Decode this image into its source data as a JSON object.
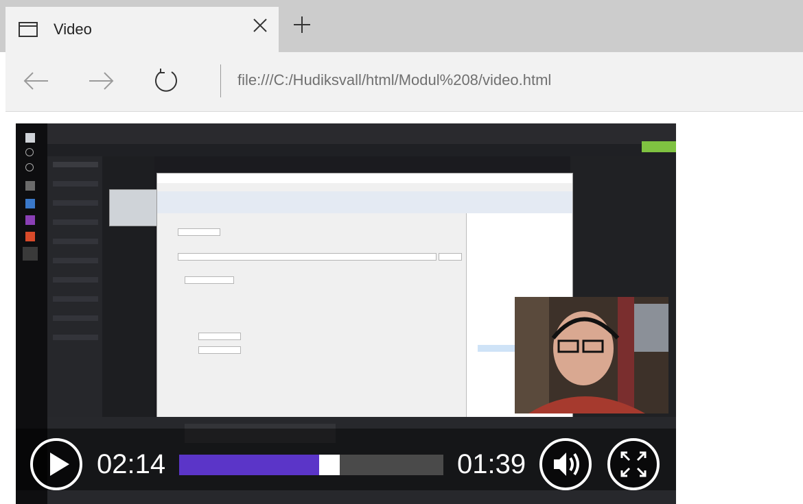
{
  "tab": {
    "title": "Video",
    "icon": "browser-window-icon",
    "close_icon": "close-icon",
    "new_tab_icon": "plus-icon"
  },
  "nav": {
    "back_icon": "arrow-left-icon",
    "forward_icon": "arrow-right-icon",
    "refresh_icon": "refresh-icon",
    "address": "file:///C:/Hudiksvall/html/Modul%208/video.html"
  },
  "player": {
    "current_time": "02:14",
    "remaining_time": "01:39",
    "progress": 0.575,
    "progress_color": "#5b35c8",
    "play_icon": "play-icon",
    "volume_icon": "volume-icon",
    "fullscreen_icon": "fullscreen-icon"
  },
  "colors": {
    "tabbar_bg": "#cccccc",
    "tab_bg": "#f2f2f2",
    "video_bg": "#1b1b1f"
  }
}
